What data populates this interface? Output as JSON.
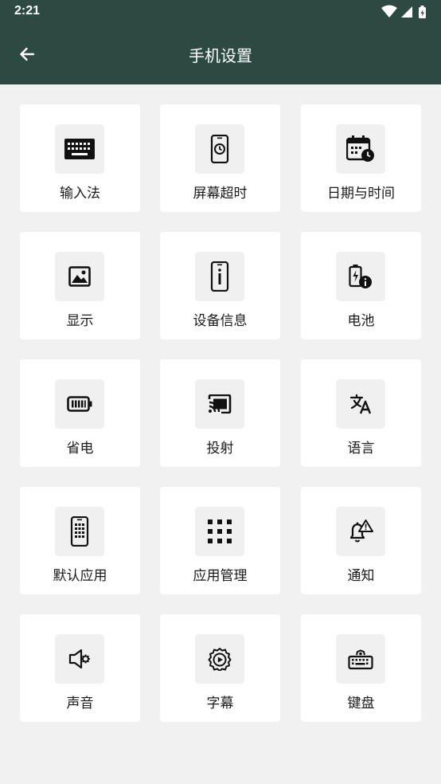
{
  "status_bar": {
    "time": "2:21"
  },
  "app_bar": {
    "title": "手机设置"
  },
  "settings": [
    {
      "label": "输入法",
      "icon": "keyboard-icon"
    },
    {
      "label": "屏幕超时",
      "icon": "screen-timeout-icon"
    },
    {
      "label": "日期与时间",
      "icon": "calendar-clock-icon"
    },
    {
      "label": "显示",
      "icon": "image-icon"
    },
    {
      "label": "设备信息",
      "icon": "device-info-icon"
    },
    {
      "label": "电池",
      "icon": "battery-info-icon"
    },
    {
      "label": "省电",
      "icon": "battery-saver-icon"
    },
    {
      "label": "投射",
      "icon": "cast-icon"
    },
    {
      "label": "语言",
      "icon": "translate-icon"
    },
    {
      "label": "默认应用",
      "icon": "phone-keypad-icon"
    },
    {
      "label": "应用管理",
      "icon": "apps-grid-icon"
    },
    {
      "label": "通知",
      "icon": "notification-alert-icon"
    },
    {
      "label": "声音",
      "icon": "speaker-settings-icon"
    },
    {
      "label": "字幕",
      "icon": "caption-settings-icon"
    },
    {
      "label": "键盘",
      "icon": "keyboard-settings-icon"
    }
  ]
}
